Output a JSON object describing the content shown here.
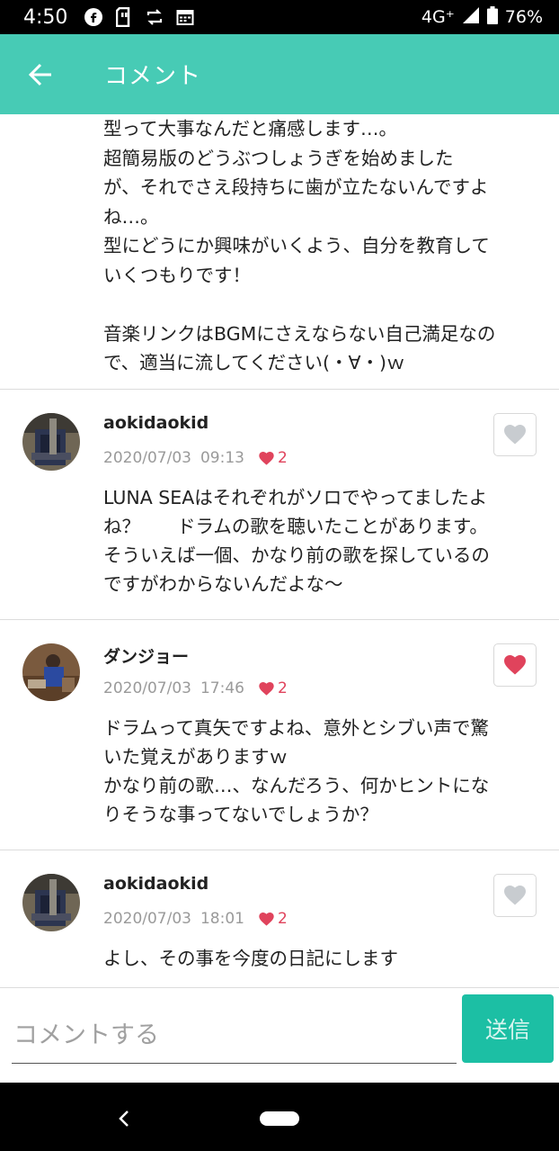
{
  "status_bar": {
    "time": "4:50",
    "network": "4G⁺",
    "battery": "76%",
    "icons": [
      "facebook-icon",
      "sim-icon",
      "sync-icon",
      "calendar-icon",
      "signal-icon",
      "battery-icon"
    ]
  },
  "header": {
    "title": "コメント",
    "back_icon": "arrow-left-icon",
    "background": "#47cbb5"
  },
  "post_tail": {
    "lines": [
      "型って大事なんだと痛感します…。",
      "超簡易版のどうぶつしょうぎを始めました",
      "が、それでさえ段持ちに歯が立たないんですよ",
      "ね…。",
      "型にどうにか興味がいくよう、自分を教育して",
      "いくつもりです！",
      "",
      "音楽リンクはBGMにさえならない自己満足なの",
      "で、適当に流してください(・∀・)ｗ"
    ]
  },
  "comments": [
    {
      "author": "aokidaokid",
      "date": "2020/07/03",
      "time": "09:13",
      "likes": "2",
      "liked": false,
      "lines": [
        "LUNA SEAはそれぞれがソロでやってましたよ",
        "ね？　　ドラムの歌を聴いたことがあります。",
        "そういえば一個、かなり前の歌を探しているの",
        "ですがわからないんだよな〜"
      ]
    },
    {
      "author": "ダンジョー",
      "date": "2020/07/03",
      "time": "17:46",
      "likes": "2",
      "liked": true,
      "lines": [
        "ドラムって真矢ですよね、意外とシブい声で驚",
        "いた覚えがありますｗ",
        "かなり前の歌…、なんだろう、何かヒントにな",
        "りそうな事ってないでしょうか？"
      ]
    },
    {
      "author": "aokidaokid",
      "date": "2020/07/03",
      "time": "18:01",
      "likes": "2",
      "liked": false,
      "lines": [
        "よし、その事を今度の日記にします"
      ]
    }
  ],
  "input": {
    "placeholder": "コメントする",
    "value": "",
    "send_label": "送信"
  },
  "colors": {
    "accent": "#47cbb5",
    "send": "#1cbfa4",
    "heart": "#e0435c",
    "heart_inactive": "#c8ccd0"
  }
}
